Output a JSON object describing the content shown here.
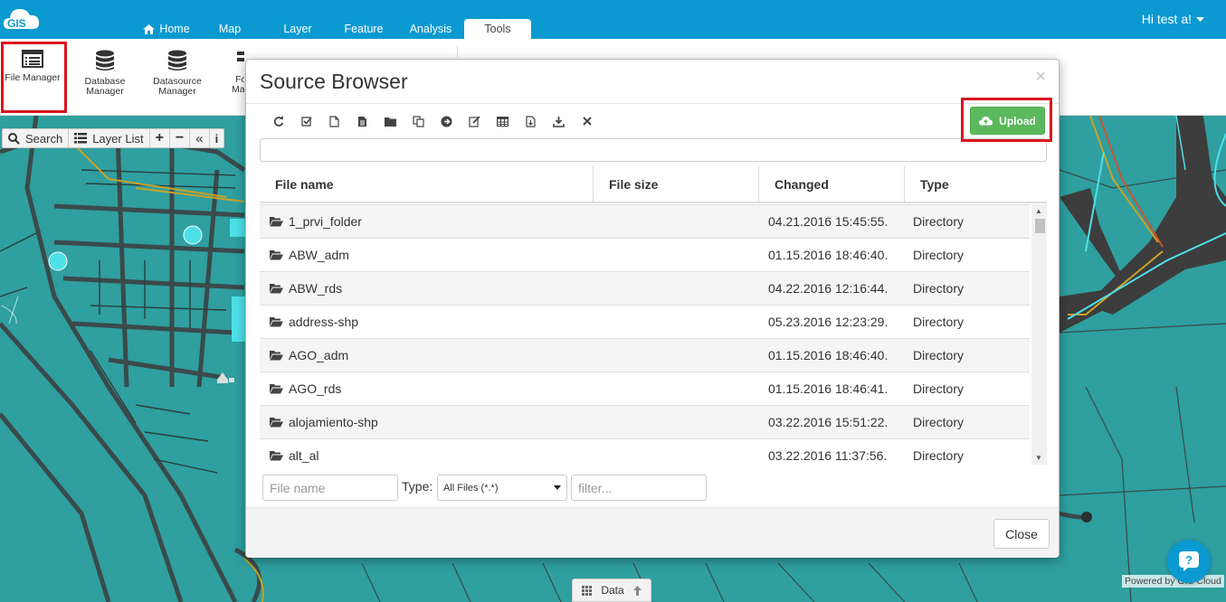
{
  "app": {
    "logo_text": "GIS",
    "user_menu": "Hi test a!"
  },
  "nav": {
    "tabs": [
      {
        "label": "Home",
        "icon": "home-icon"
      },
      {
        "label": "Map"
      },
      {
        "label": "Layer"
      },
      {
        "label": "Feature"
      },
      {
        "label": "Analysis"
      },
      {
        "label": "Tools",
        "active": true
      }
    ]
  },
  "ribbon": {
    "file_manager": "File Manager",
    "database_manager": "Database Manager",
    "datasource_manager": "Datasource Manager",
    "partial_1": "Fo",
    "partial_2": "Ma"
  },
  "map_toolbar": {
    "search": "Search",
    "layer_list": "Layer List",
    "zoom_in": "+",
    "zoom_out": "−",
    "collapse": "«",
    "info": "i"
  },
  "modal": {
    "title": "Source Browser",
    "close_x": "×",
    "upload_label": "Upload",
    "toolbar_icons": [
      "refresh-icon",
      "check-all-icon",
      "new-file-icon",
      "file-icon",
      "folder-icon",
      "copy-icon",
      "move-icon",
      "edit-icon",
      "table-icon",
      "file-export-icon",
      "download-icon",
      "delete-icon"
    ],
    "path_value": "",
    "columns": [
      "File name",
      "File size",
      "Changed",
      "Type"
    ],
    "rows": [
      {
        "name": "1_prvi_folder",
        "size": "",
        "changed": "04.21.2016 15:45:55.",
        "type": "Directory"
      },
      {
        "name": "ABW_adm",
        "size": "",
        "changed": "01.15.2016 18:46:40.",
        "type": "Directory"
      },
      {
        "name": "ABW_rds",
        "size": "",
        "changed": "04.22.2016 12:16:44.",
        "type": "Directory"
      },
      {
        "name": "address-shp",
        "size": "",
        "changed": "05.23.2016 12:23:29.",
        "type": "Directory"
      },
      {
        "name": "AGO_adm",
        "size": "",
        "changed": "01.15.2016 18:46:40.",
        "type": "Directory"
      },
      {
        "name": "AGO_rds",
        "size": "",
        "changed": "01.15.2016 18:46:41.",
        "type": "Directory"
      },
      {
        "name": "alojamiento-shp",
        "size": "",
        "changed": "03.22.2016 15:51:22.",
        "type": "Directory"
      },
      {
        "name": "alt_al",
        "size": "",
        "changed": "03.22.2016 11:37:56.",
        "type": "Directory"
      }
    ],
    "filter": {
      "name_placeholder": "File name",
      "type_label": "Type:",
      "type_selected": "All Files (*.*)",
      "filter_placeholder": "filter..."
    },
    "close_label": "Close"
  },
  "bottom": {
    "data_tab": "Data",
    "powered_by": "Powered by GIS Cloud"
  },
  "colors": {
    "topbar": "#0a9ad1",
    "map_water": "#2f9fa0",
    "upload_green": "#5cb85c",
    "highlight_red": "#d9151c"
  }
}
